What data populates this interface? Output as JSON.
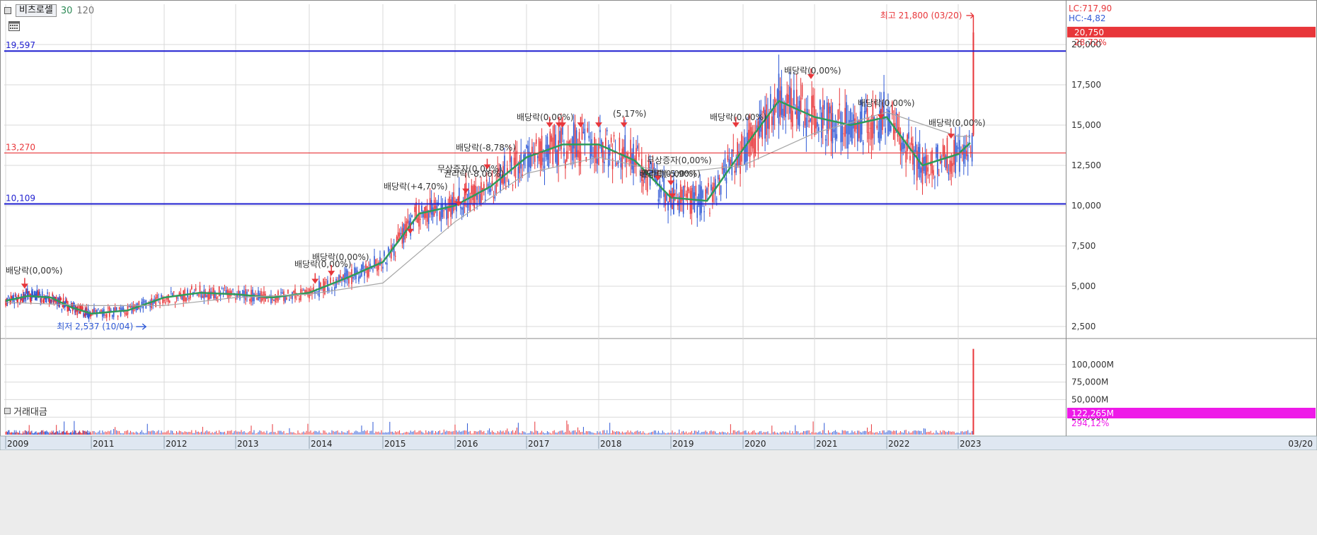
{
  "toolbar": {
    "stock_name": "비츠로셀",
    "ma_short": "30",
    "ma_long": "120"
  },
  "icons": {
    "calendar": "calendar-icon"
  },
  "colors": {
    "up": "#e8363a",
    "down": "#2f59d6",
    "ma30": "#2e9b5a",
    "ma120": "#a6a6a6",
    "hline_blue": "#1f1fd0",
    "hline_red": "#e8363a",
    "grid": "#d9d9d9",
    "axis_bg": "#dfe7f1"
  },
  "price_axis": {
    "ticks": [
      "20,000",
      "17,500",
      "15,000",
      "12,500",
      "10,000",
      "7,500",
      "5,000",
      "2,500"
    ],
    "ymin": 1800,
    "ymax": 22500
  },
  "volume_axis": {
    "ticks": [
      "100,000M",
      "75,000M",
      "50,000M",
      "25,000M"
    ]
  },
  "x_axis": {
    "labels": [
      "2009",
      "2011",
      "2012",
      "2013",
      "2014",
      "2015",
      "2016",
      "2017",
      "2018",
      "2019",
      "2020",
      "2021",
      "2022",
      "2023"
    ],
    "right_label": "03/20"
  },
  "right_info": {
    "lc": "LC:717,90",
    "hc": "HC:-4,82",
    "last_price": "20,750",
    "change": "28,72%",
    "vol_value": "122,265M",
    "vol_change": "294,12%"
  },
  "hlines": [
    {
      "label": "19,597",
      "value": 19597,
      "color": "blue"
    },
    {
      "label": "13,270",
      "value": 13270,
      "color": "red"
    },
    {
      "label": "10,109",
      "value": 10109,
      "color": "blue"
    }
  ],
  "annotations": {
    "high": "최고 21,800 (03/20)",
    "low": "최저 2,537 (10/04)"
  },
  "events": [
    "배당락(0,00%)",
    "배당락(0,00%)",
    "배당락(0,00%)",
    "배당락(+4,70%)",
    "권리락(-8,06%)",
    "무상증자(0,00%)",
    "배당락(-8,78%)",
    "배당락(0,00%)",
    "(5,17%)",
    "무상증자(0,00%)",
    "권리락(-5,90%)",
    "배당락(0,00%)",
    "배당락(0,00%)",
    "배당락(0,00%)",
    "배당락(0,00%)",
    "배당락(0,00%)"
  ],
  "volume_title": "거래대금",
  "chart_data": {
    "type": "line",
    "title": "",
    "series": [
      {
        "name": "30",
        "x": [
          "2009-01",
          "2009-07",
          "2010-01",
          "2010-07",
          "2011-01",
          "2011-07",
          "2012-01",
          "2012-07",
          "2013-01",
          "2013-07",
          "2014-01",
          "2014-07",
          "2015-01",
          "2015-07",
          "2016-01",
          "2016-07",
          "2017-01",
          "2017-07",
          "2018-01",
          "2018-07",
          "2019-01",
          "2019-07",
          "2020-01",
          "2020-07",
          "2021-01",
          "2021-07",
          "2022-01",
          "2022-07",
          "2023-01",
          "2023-03"
        ],
        "values": [
          4100,
          4400,
          4300,
          3700,
          3300,
          3500,
          4300,
          4600,
          4500,
          4300,
          4600,
          5500,
          6500,
          9500,
          10000,
          11200,
          13000,
          13800,
          13800,
          12800,
          10500,
          10300,
          13500,
          16500,
          15500,
          15000,
          15500,
          12500,
          13200,
          13900
        ]
      },
      {
        "name": "120",
        "x": [
          "2009-01",
          "2010-01",
          "2011-01",
          "2012-01",
          "2013-01",
          "2014-01",
          "2015-01",
          "2016-01",
          "2017-01",
          "2018-01",
          "2019-01",
          "2020-01",
          "2021-01",
          "2022-01",
          "2023-01",
          "2023-03"
        ],
        "values": [
          4000,
          3900,
          3800,
          3800,
          4300,
          4500,
          5200,
          9000,
          12000,
          13000,
          12000,
          12500,
          14500,
          15800,
          14300,
          14300
        ]
      }
    ],
    "high": 21800,
    "low": 2537,
    "last": 20750,
    "ylim": [
      2500,
      22500
    ]
  }
}
